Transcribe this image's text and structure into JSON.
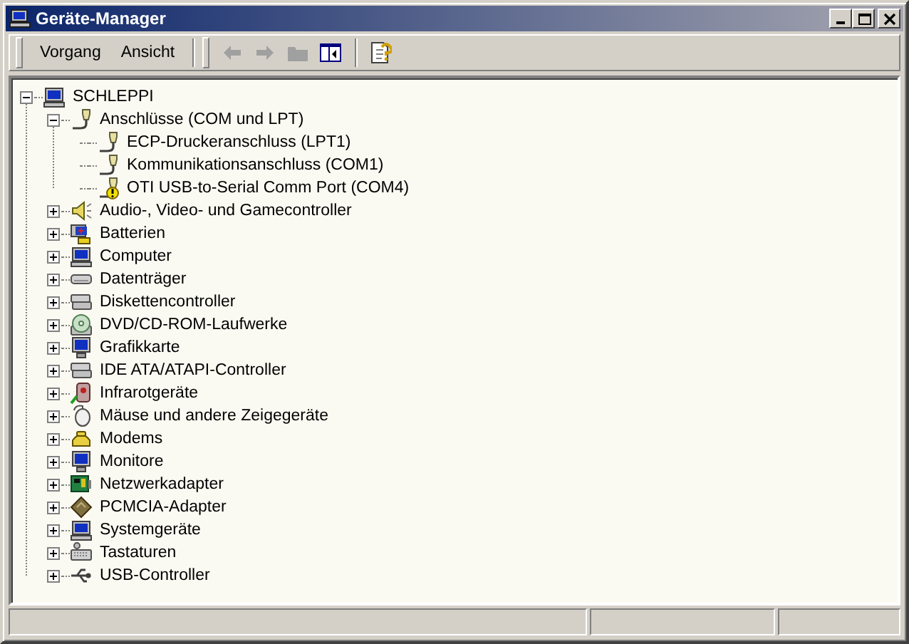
{
  "window": {
    "title": "Geräte-Manager"
  },
  "menu": [
    {
      "label": "Vorgang"
    },
    {
      "label": "Ansicht"
    }
  ],
  "toolbar": [
    {
      "kind": "back",
      "disabled": true
    },
    {
      "kind": "forward",
      "disabled": true
    },
    {
      "kind": "folder",
      "disabled": true
    },
    {
      "kind": "panel",
      "disabled": false
    },
    {
      "kind": "help",
      "disabled": false
    }
  ],
  "tree": {
    "label": "SCHLEPPI",
    "kind": "computer",
    "expanded": true,
    "children": [
      {
        "label": "Anschlüsse (COM und LPT)",
        "kind": "port",
        "expanded": true,
        "children": [
          {
            "label": "ECP-Druckeranschluss (LPT1)",
            "kind": "port",
            "warning": false
          },
          {
            "label": "Kommunikationsanschluss (COM1)",
            "kind": "port",
            "warning": false
          },
          {
            "label": "OTI USB-to-Serial Comm Port (COM4)",
            "kind": "port",
            "warning": true
          }
        ]
      },
      {
        "label": "Audio-, Video- und Gamecontroller",
        "kind": "speaker",
        "expanded": false
      },
      {
        "label": "Batterien",
        "kind": "battery",
        "expanded": false
      },
      {
        "label": "Computer",
        "kind": "computer",
        "expanded": false
      },
      {
        "label": "Datenträger",
        "kind": "disk",
        "expanded": false
      },
      {
        "label": "Diskettencontroller",
        "kind": "controller",
        "expanded": false
      },
      {
        "label": "DVD/CD-ROM-Laufwerke",
        "kind": "cdrom",
        "expanded": false
      },
      {
        "label": "Grafikkarte",
        "kind": "monitor",
        "expanded": false
      },
      {
        "label": "IDE ATA/ATAPI-Controller",
        "kind": "controller",
        "expanded": false
      },
      {
        "label": "Infrarotgeräte",
        "kind": "infrared",
        "expanded": false
      },
      {
        "label": "Mäuse und andere Zeigegeräte",
        "kind": "mouse",
        "expanded": false
      },
      {
        "label": "Modems",
        "kind": "modem",
        "expanded": false
      },
      {
        "label": "Monitore",
        "kind": "monitor",
        "expanded": false
      },
      {
        "label": "Netzwerkadapter",
        "kind": "network",
        "expanded": false
      },
      {
        "label": "PCMCIA-Adapter",
        "kind": "card",
        "expanded": false
      },
      {
        "label": "Systemgeräte",
        "kind": "computer",
        "expanded": false
      },
      {
        "label": "Tastaturen",
        "kind": "keyboard",
        "expanded": false
      },
      {
        "label": "USB-Controller",
        "kind": "usb",
        "expanded": false
      }
    ]
  }
}
